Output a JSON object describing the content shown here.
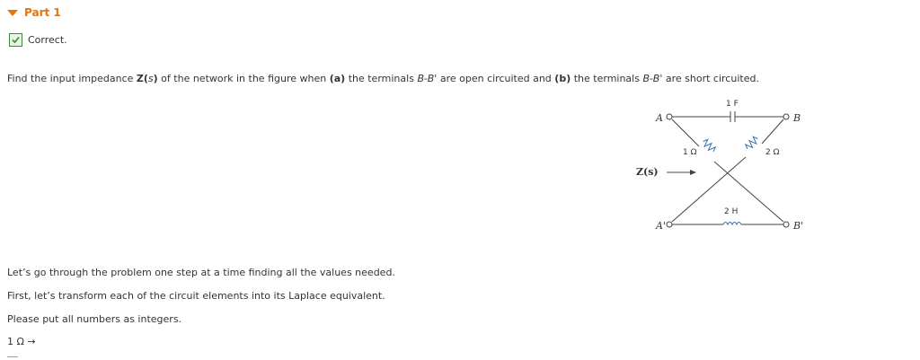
{
  "part": {
    "title": "Part 1"
  },
  "status": {
    "text": "Correct."
  },
  "problem": {
    "prefix": "Find the input impedance ",
    "z": "Z(",
    "s": "s",
    "close": ")",
    "mid1": " of the network in the figure when ",
    "a": "(a)",
    "mid2": " the terminals ",
    "bb1": "B-B'",
    "mid3": " are open circuited and ",
    "b": "(b)",
    "mid4": " the terminals ",
    "bb2": "B-B'",
    "end": " are short circuited."
  },
  "circuit": {
    "capacitor": "1 F",
    "r1": "1 Ω",
    "r2": "2 Ω",
    "inductor": "2 H",
    "node_a": "A",
    "node_a_prime": "A'",
    "node_b": "B",
    "node_b_prime": "B'",
    "zs": "Z(s)"
  },
  "steps": {
    "line1": "Let’s go through the problem one step at a time finding all the values needed.",
    "line2": "First, let’s transform each of the circuit elements into its Laplace equivalent.",
    "line3": "Please put all numbers as integers."
  },
  "answer": {
    "label": "1 Ω →"
  }
}
